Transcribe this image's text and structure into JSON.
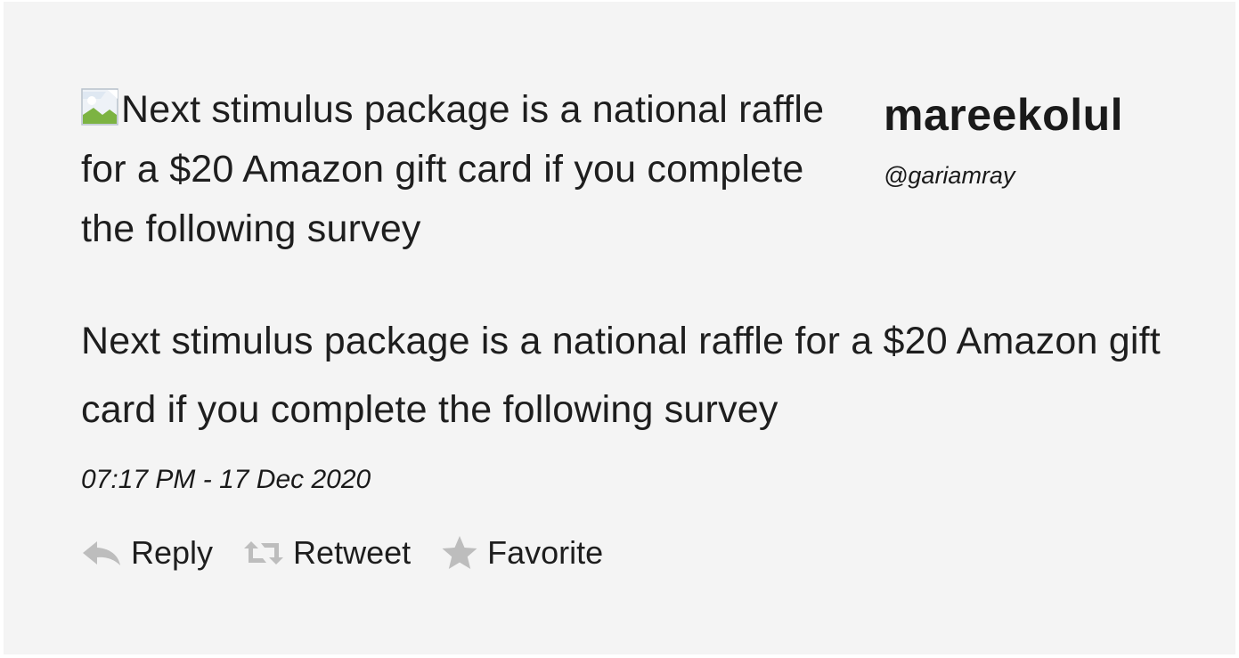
{
  "tweet": {
    "image_alt": "Next stimulus package is a national raffle for a $20 Amazon gift card if you complete the following survey",
    "text": "Next stimulus package is a national raffle for a $20 Amazon gift card if you complete the following survey",
    "timestamp": "07:17 PM - 17 Dec 2020"
  },
  "user": {
    "name": "mareekolul",
    "handle": "@gariamray"
  },
  "actions": {
    "reply": {
      "label": "Reply",
      "icon": "reply-icon"
    },
    "retweet": {
      "label": "Retweet",
      "icon": "retweet-icon"
    },
    "favorite": {
      "label": "Favorite",
      "icon": "star-icon"
    }
  },
  "colors": {
    "background": "#f4f4f4",
    "text": "#1e1e1e",
    "icon": "#bdbdbd"
  }
}
